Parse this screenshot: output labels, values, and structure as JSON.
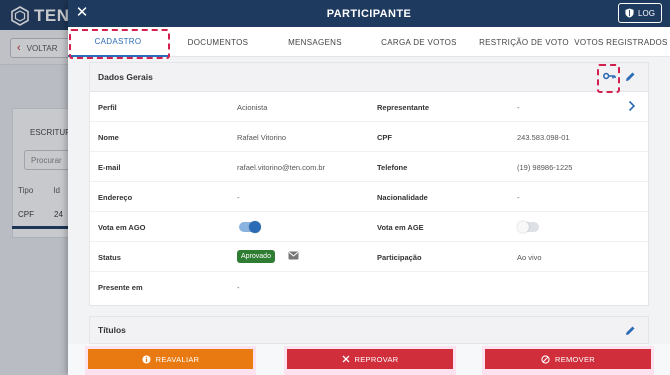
{
  "background": {
    "logo_text": "TEN",
    "back_label": "VOLTAR",
    "tab_label": "ESCRITUR",
    "search_placeholder": "Procurar",
    "col_tipo": "Tipo",
    "col_id": "Id",
    "row_tipo": "CPF",
    "row_id": "24"
  },
  "drawer": {
    "title": "PARTICIPANTE",
    "log_label": "LOG",
    "tabs": [
      {
        "label": "CADASTRO",
        "active": true
      },
      {
        "label": "DOCUMENTOS",
        "active": false
      },
      {
        "label": "MENSAGENS",
        "active": false
      },
      {
        "label": "CARGA DE VOTOS",
        "active": false
      },
      {
        "label": "RESTRIÇÃO DE VOTO",
        "active": false
      },
      {
        "label": "VOTOS REGISTRADOS",
        "active": false
      }
    ]
  },
  "dados_gerais": {
    "title": "Dados Gerais",
    "rows": [
      {
        "l1": "Perfil",
        "v1": "Acionista",
        "l2": "Representante",
        "v2": "-"
      },
      {
        "l1": "Nome",
        "v1": "Rafael Vitorino",
        "l2": "CPF",
        "v2": "243.583.098-01"
      },
      {
        "l1": "E-mail",
        "v1": "rafael.vitorino@ten.com.br",
        "l2": "Telefone",
        "v2": "(19) 98986-1225"
      },
      {
        "l1": "Endereço",
        "v1": "-",
        "l2": "Nacionalidade",
        "v2": "-"
      },
      {
        "l1": "Vota em AGO",
        "v1_toggle": true,
        "l2": "Vota em AGE",
        "v2_toggle": false
      },
      {
        "l1": "Status",
        "v1_badge": "Aprovado",
        "l2": "Participação",
        "v2": "Ao vivo"
      },
      {
        "l1": "Presente em",
        "v1": "-"
      }
    ]
  },
  "titulos": {
    "title": "Títulos"
  },
  "footer": {
    "reavaliar": "REAVALIAR",
    "reprovar": "REPROVAR",
    "remover": "REMOVER"
  },
  "colors": {
    "header": "#1e3a5f",
    "accent": "#2c6bb5",
    "approved": "#2e7d32",
    "orange": "#e97a12",
    "red": "#d12e3c",
    "highlight_dash": "#d21f4d"
  },
  "icons": [
    "close-icon",
    "shield-icon",
    "key-icon",
    "pencil-icon",
    "chevron-right-icon",
    "mail-icon",
    "info-icon",
    "x-icon",
    "ban-icon"
  ]
}
